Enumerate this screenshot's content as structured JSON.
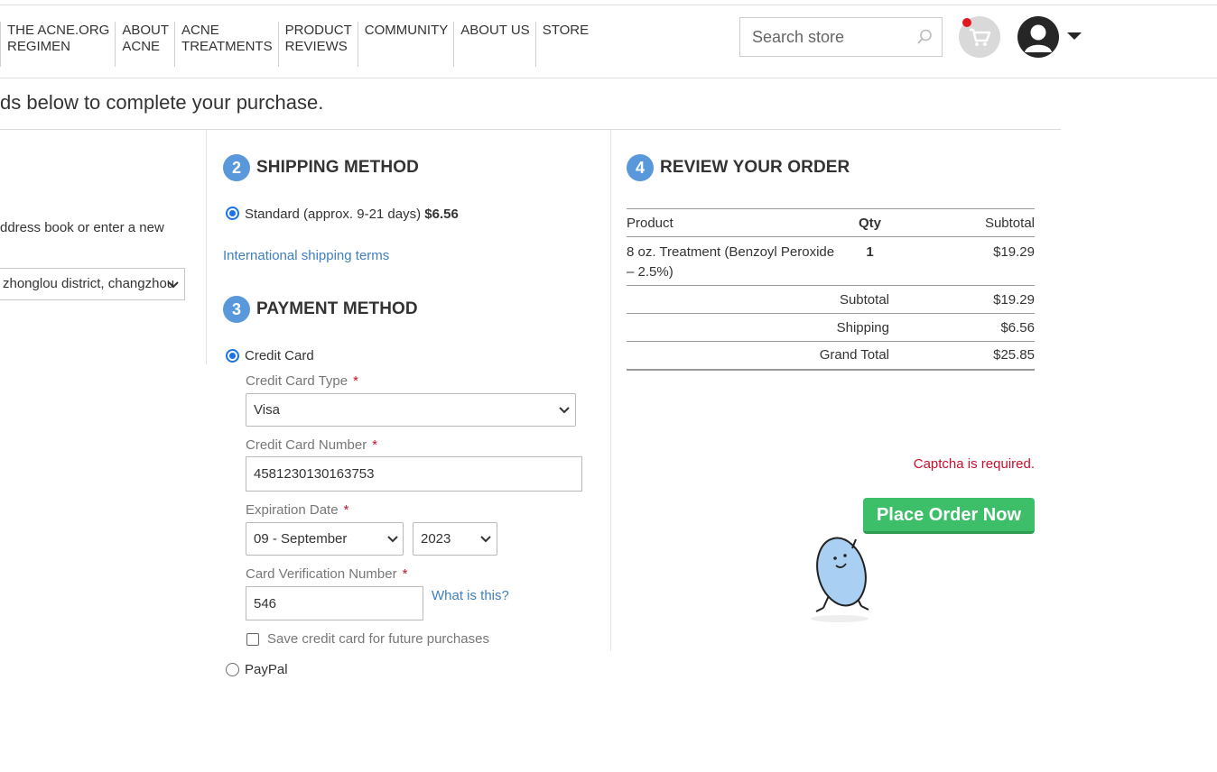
{
  "nav": {
    "items": [
      {
        "label": "THE ACNE.ORG\nREGIMEN"
      },
      {
        "label": "ABOUT\nACNE"
      },
      {
        "label": "ACNE\nTREATMENTS"
      },
      {
        "label": "PRODUCT\nREVIEWS"
      },
      {
        "label": "COMMUNITY"
      },
      {
        "label": "ABOUT US"
      },
      {
        "label": "STORE"
      }
    ],
    "search_placeholder": "Search store"
  },
  "page": {
    "subtitle": "ds below to complete your purchase."
  },
  "address": {
    "instruction": "ddress book or enter a new",
    "selected": "zhonglou district, changzhou"
  },
  "shipping": {
    "number": "2",
    "title": "SHIPPING METHOD",
    "option_label": "Standard (approx. 9-21 days)",
    "option_price": "$6.56",
    "terms_link": "International shipping terms"
  },
  "payment": {
    "number": "3",
    "title": "PAYMENT METHOD",
    "credit_card_label": "Credit Card",
    "card_type_label": "Credit Card Type",
    "card_type_value": "Visa",
    "card_number_label": "Credit Card Number",
    "card_number_value": "4581230130163753",
    "expiration_label": "Expiration Date",
    "exp_month": "09 - September",
    "exp_year": "2023",
    "cvv_label": "Card Verification Number",
    "cvv_value": "546",
    "cvv_help": "What is this?",
    "save_card_label": "Save credit card for future purchases",
    "paypal_label": "PayPal",
    "required_mark": "*"
  },
  "review": {
    "number": "4",
    "title": "REVIEW YOUR ORDER",
    "col_product": "Product",
    "col_qty": "Qty",
    "col_subtotal": "Subtotal",
    "item": {
      "name": "8 oz. Treatment (Benzoyl Peroxide – 2.5%)",
      "qty": "1",
      "subtotal": "$19.29"
    },
    "subtotal_label": "Subtotal",
    "subtotal_value": "$19.29",
    "shipping_label": "Shipping",
    "shipping_value": "$6.56",
    "grand_total_label": "Grand Total",
    "grand_total_value": "$25.85",
    "captcha_error": "Captcha is required.",
    "place_order": "Place Order Now"
  },
  "colors": {
    "accent_blue": "#5a98dc",
    "link": "#3f7fbf",
    "error": "#c8102e",
    "button_green": "#3dbf6a"
  }
}
